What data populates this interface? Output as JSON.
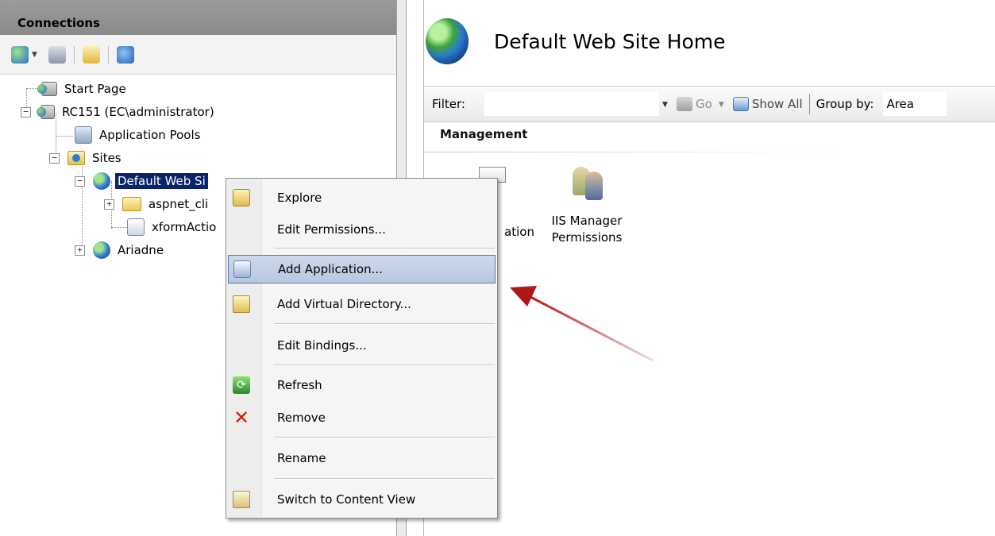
{
  "connections": {
    "header": "Connections",
    "toolbar_icons": [
      "connect-globe-icon",
      "save-icon",
      "up-folder-icon",
      "disconnect-icon"
    ]
  },
  "tree": {
    "start_page": "Start Page",
    "server": "RC151 (EC\\administrator)",
    "app_pools": "Application Pools",
    "sites": "Sites",
    "default_site": "Default Web Si",
    "aspnet_client": "aspnet_cli",
    "xform": "xformActio",
    "ariadne": "Ariadne",
    "expander_minus": "−",
    "expander_plus": "+"
  },
  "home": {
    "title": "Default Web Site Home"
  },
  "filter_bar": {
    "filter_label": "Filter:",
    "filter_value": "",
    "go_label": "Go",
    "show_all_label": "Show All",
    "group_by_label": "Group by:",
    "group_by_value": "Area"
  },
  "management": {
    "section_title": "Management",
    "features": [
      {
        "label": "ation",
        "icon": "configuration-icon"
      },
      {
        "label": "IIS Manager\nPermissions",
        "icon": "users-icon"
      }
    ]
  },
  "context_menu": {
    "items": [
      {
        "label": "Explore",
        "icon": "explore-icon"
      },
      {
        "label": "Edit Permissions...",
        "icon": ""
      },
      {
        "label": "Add Application...",
        "icon": "add-application-icon",
        "highlighted": true
      },
      {
        "label": "Add Virtual Directory...",
        "icon": "add-virtual-directory-icon"
      },
      {
        "label": "Edit Bindings...",
        "icon": ""
      },
      {
        "label": "Refresh",
        "icon": "refresh-icon"
      },
      {
        "label": "Remove",
        "icon": "remove-icon"
      },
      {
        "label": "Rename",
        "icon": ""
      },
      {
        "label": "Switch to Content View",
        "icon": "content-view-icon"
      }
    ]
  },
  "colors": {
    "selection": "#0a246a",
    "highlight": "#b8c7e0",
    "arrow": "#b01818"
  }
}
